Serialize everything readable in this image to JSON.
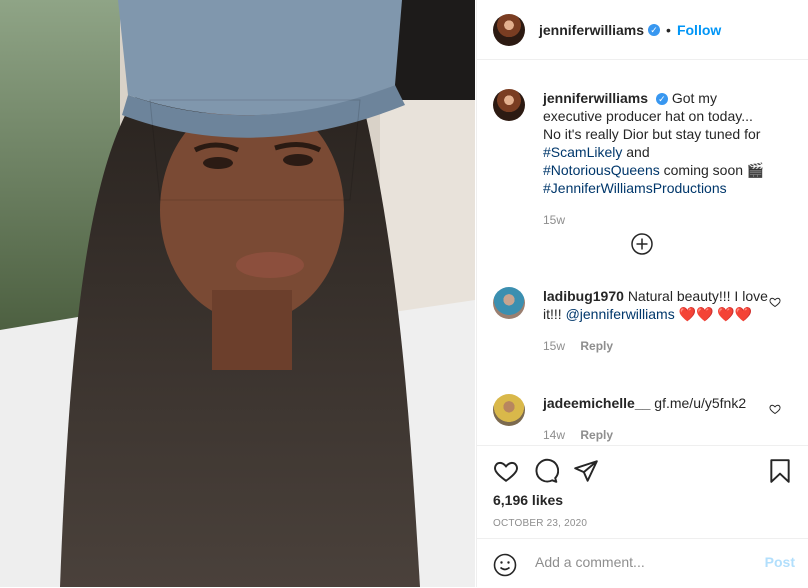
{
  "header": {
    "username": "jenniferwilliams",
    "separator": "•",
    "follow_label": "Follow"
  },
  "caption": {
    "username": "jenniferwilliams",
    "text_part1": "Got my executive producer hat on today... No it's really Dior but stay tuned for ",
    "tag1": "#ScamLikely",
    "text_part2": " and ",
    "tag2": "#NotoriousQueens",
    "text_part3": " coming soon 🎬 ",
    "tag3": "#JenniferWilliamsProductions",
    "age": "15w"
  },
  "comments": [
    {
      "username": "ladibug1970",
      "text_part1": "Natural beauty!!! I love it!!! ",
      "mention": "@jenniferwilliams",
      "emoji": " ❤️❤️ ❤️❤️",
      "age": "15w",
      "reply_label": "Reply"
    },
    {
      "username": "jadeemichelle__",
      "text": "gf.me/u/y5fnk2",
      "age": "14w",
      "reply_label": "Reply"
    }
  ],
  "actions": {
    "likes": "6,196 likes",
    "date": "OCTOBER 23, 2020"
  },
  "add_comment": {
    "placeholder": "Add a comment...",
    "post_label": "Post"
  },
  "colors": {
    "accent": "#0095f6",
    "muted": "#8e8e8e",
    "heart": "#ed4956"
  }
}
